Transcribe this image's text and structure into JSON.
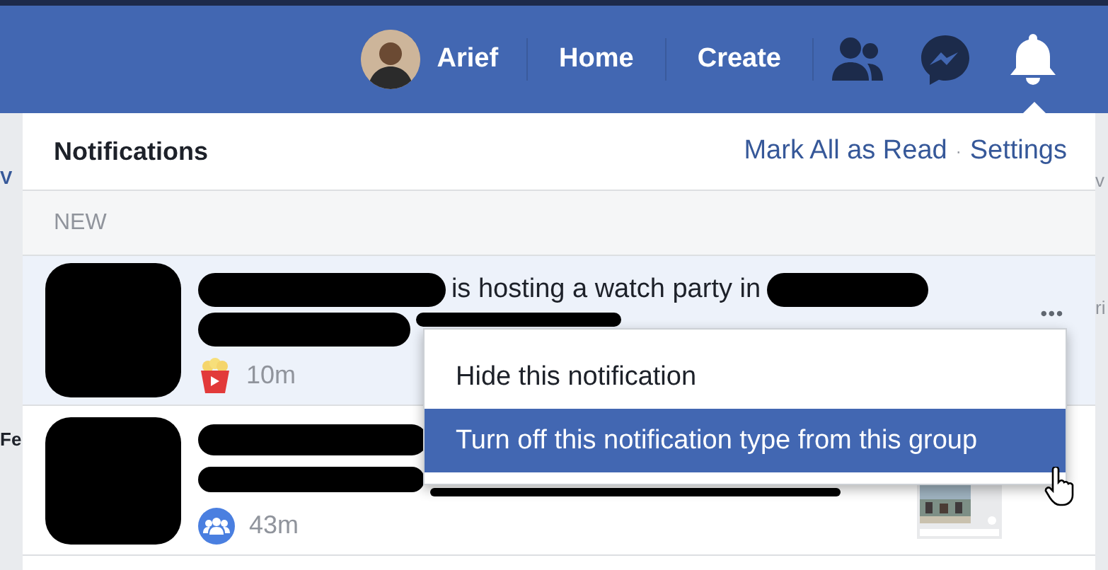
{
  "top_bar": {
    "user": {
      "name": "Arief"
    },
    "nav_links": [
      "Home",
      "Create"
    ],
    "icons": [
      {
        "kind": "friends",
        "active": false
      },
      {
        "kind": "messenger",
        "active": false
      },
      {
        "kind": "bell",
        "active": true
      }
    ]
  },
  "page_fragments": {
    "left": [
      "V",
      "Fe"
    ],
    "right": [
      "v",
      "ri"
    ]
  },
  "notifications_panel": {
    "title": "Notifications",
    "actions": [
      "Mark All as Read",
      "Settings"
    ],
    "separator": "·",
    "section": "NEW",
    "items": [
      {
        "kind": "watch-party",
        "text": "is hosting a watch party in",
        "time": "10m",
        "unread": true,
        "more": "•••"
      },
      {
        "kind": "group",
        "time": "43m",
        "unread": false
      }
    ]
  },
  "context_menu": {
    "items": [
      {
        "label": "Hide this notification",
        "selected": false
      },
      {
        "label": "Turn off this notification type from this group",
        "selected": true
      }
    ]
  }
}
